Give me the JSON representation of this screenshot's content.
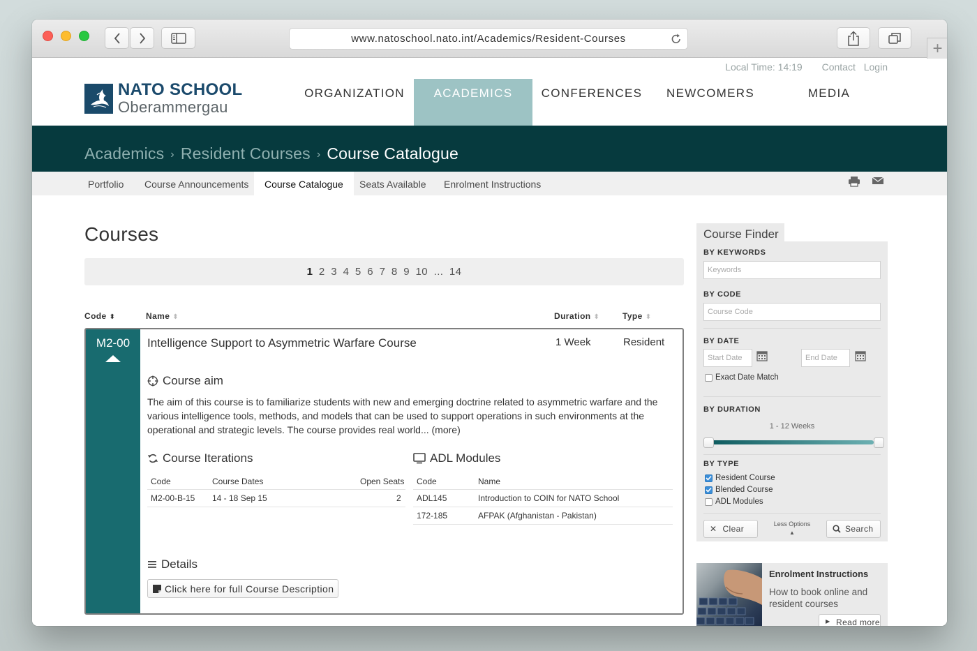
{
  "browser": {
    "url": "www.natoschool.nato.int/Academics/Resident-Courses"
  },
  "header": {
    "local_time": "Local Time: 14:19",
    "contact": "Contact",
    "login": "Login",
    "logo_line1": "NATO SCHOOL",
    "logo_line2": "Oberammergau",
    "nav": [
      {
        "label": "ORGANIZATION"
      },
      {
        "label": "ACADEMICS"
      },
      {
        "label": "CONFERENCES"
      },
      {
        "label": "NEWCOMERS"
      },
      {
        "label": "MEDIA"
      }
    ],
    "active_nav": "ACADEMICS"
  },
  "breadcrumb": {
    "items": [
      "Academics",
      "Resident Courses",
      "Course Catalogue"
    ],
    "separator": "›"
  },
  "subnav": {
    "items": [
      {
        "label": "Portfolio"
      },
      {
        "label": "Course Announcements"
      },
      {
        "label": "Course Catalogue"
      },
      {
        "label": "Seats Available"
      },
      {
        "label": "Enrolment Instructions"
      }
    ],
    "active": "Course Catalogue",
    "icons": [
      "print-icon",
      "mail-icon"
    ]
  },
  "main": {
    "title": "Courses",
    "pagination": {
      "pages": [
        "1",
        "2",
        "3",
        "4",
        "5",
        "6",
        "7",
        "8",
        "9",
        "10",
        "...",
        "14"
      ],
      "current": "1"
    },
    "table_headers": {
      "code": "Code",
      "name": "Name",
      "duration": "Duration",
      "type": "Type"
    },
    "course": {
      "code": "M2-00",
      "name": "Intelligence Support to Asymmetric Warfare Course",
      "duration": "1 Week",
      "type": "Resident",
      "aim_heading": "Course aim",
      "aim_text": "The aim of this course is to familiarize students with new and emerging doctrine related to asymmetric warfare and the various intelligence tools, methods, and models that can be used to support operations in such environments at the operational and strategic levels. The course provides real world... (more)",
      "iterations_heading": "Course Iterations",
      "iterations_columns": [
        "Code",
        "Course Dates",
        "Open Seats"
      ],
      "iterations": [
        {
          "code": "M2-00-B-15",
          "dates": "14 - 18 Sep 15",
          "seats": "2"
        }
      ],
      "adl_heading": "ADL Modules",
      "adl_columns": [
        "Code",
        "Name"
      ],
      "adl_modules": [
        {
          "code": "ADL145",
          "name": "Introduction to COIN for NATO School"
        },
        {
          "code": "172-185",
          "name": "AFPAK (Afghanistan - Pakistan)"
        }
      ],
      "details_heading": "Details",
      "details_button": "Click here for full Course Description"
    }
  },
  "course_finder": {
    "title": "Course Finder",
    "by_keywords": "BY KEYWORDS",
    "keywords_placeholder": "Keywords",
    "by_code": "BY CODE",
    "code_placeholder": "Course Code",
    "by_date": "BY DATE",
    "start_placeholder": "Start Date",
    "end_placeholder": "End Date",
    "exact_match": "Exact Date Match",
    "exact_match_checked": false,
    "by_duration": "BY DURATION",
    "duration_range": "1 - 12 Weeks",
    "duration_min": 1,
    "duration_max": 12,
    "by_type": "BY TYPE",
    "types": [
      {
        "label": "Resident Course",
        "checked": true
      },
      {
        "label": "Blended Course",
        "checked": true
      },
      {
        "label": "ADL Modules",
        "checked": false
      }
    ],
    "clear": "Clear",
    "less_options": "Less Options",
    "search": "Search"
  },
  "promo": {
    "title": "Enrolment Instructions",
    "text": "How to book online and resident courses",
    "read_more": "Read more"
  },
  "colors": {
    "primary_dark": "#063a3e",
    "teal": "#186b6f",
    "active_nav": "#9dc3c4",
    "checkbox": "#3b8ed8"
  }
}
